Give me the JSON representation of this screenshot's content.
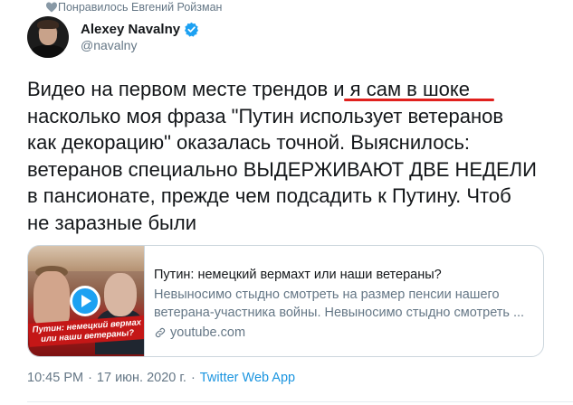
{
  "social_context": {
    "icon": "heart-icon",
    "text": "Понравилось Евгений Ройзман"
  },
  "author": {
    "display_name": "Alexey Navalny",
    "handle": "@navalny",
    "verified_icon": "verified-badge-icon",
    "verified_color": "#1da1f2"
  },
  "tweet": {
    "lines": [
      "Видео на первом месте трендов и я сам в шоке",
      "насколько моя фраза \"Путин использует ветеранов",
      "как декорацию\" оказалась точной. Выяснилось:",
      "ветеранов специально ВЫДЕРЖИВАЮТ ДВЕ НЕДЕЛИ",
      "в пансионате, прежде чем подсадить к Путину. Чтоб",
      "не заразные были"
    ],
    "underline_color": "#e0201d"
  },
  "card": {
    "thumbnail_caption_line1": "Путин: немецкий вермах",
    "thumbnail_caption_line2": "или наши ветераны?",
    "play_icon": "play-icon",
    "title": "Путин: немецкий вермахт или наши ветераны?",
    "description_line1": "Невыносимо стыдно смотреть на размер пенсии нашего",
    "description_line2": "ветерана-участника войны. Невыносимо стыдно смотреть ...",
    "link_icon": "link-icon",
    "domain": "youtube.com"
  },
  "meta": {
    "time": "10:45 PM",
    "separator": "·",
    "date": "17 июн. 2020 г.",
    "app": "Twitter Web App",
    "app_color": "#1b95e0"
  }
}
